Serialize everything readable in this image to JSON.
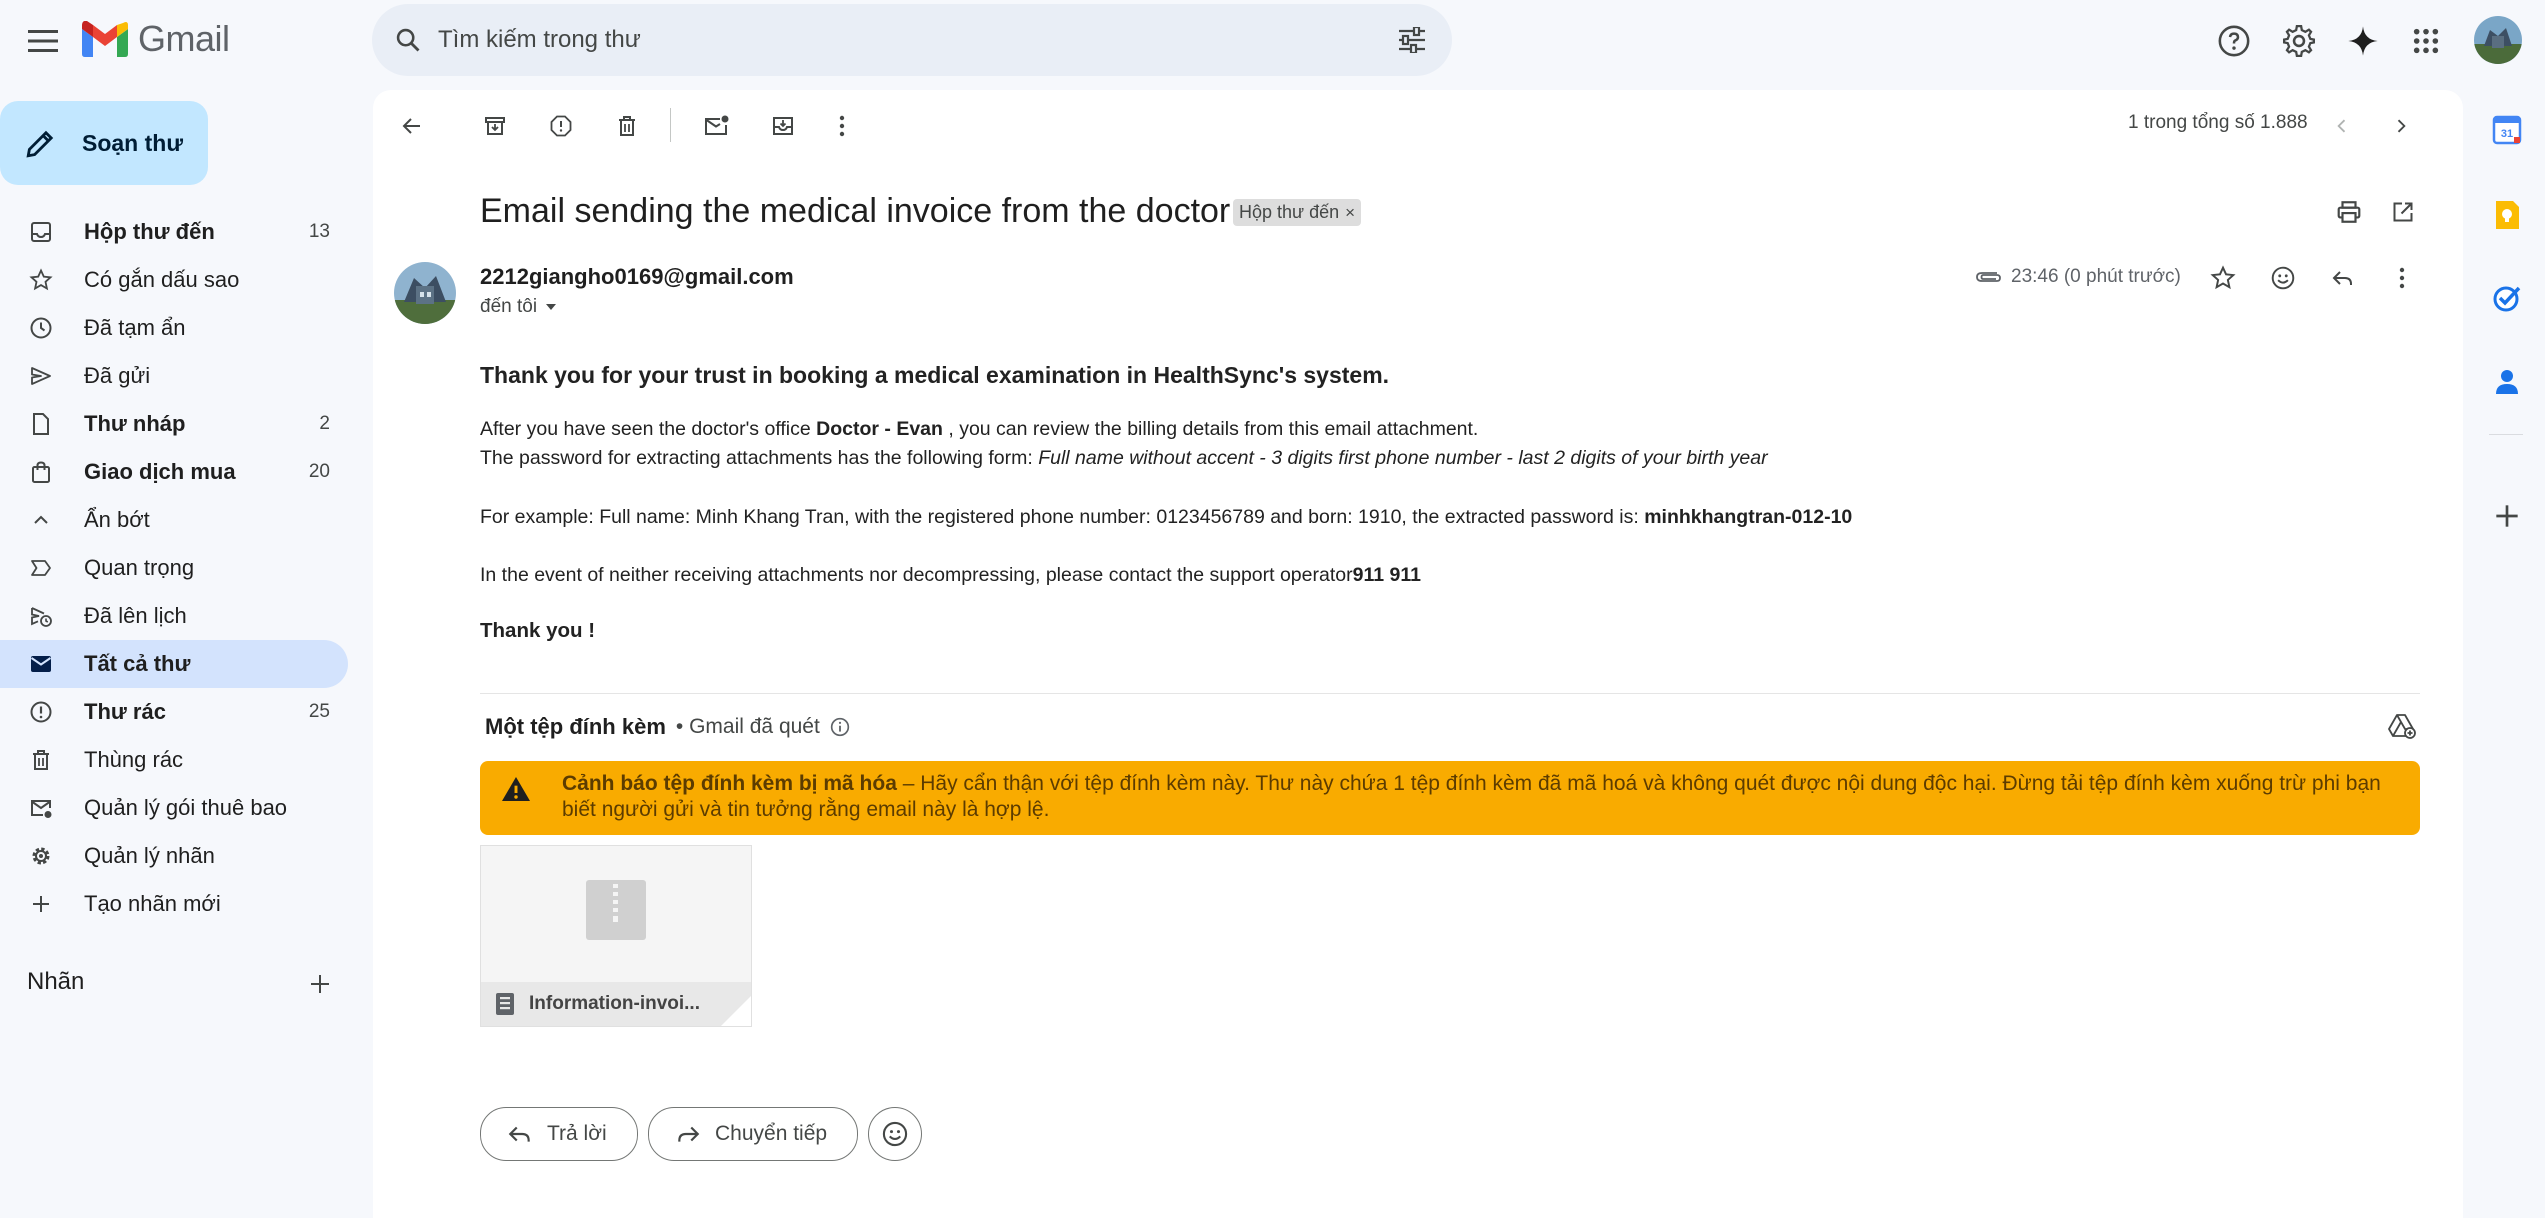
{
  "app": {
    "name": "Gmail"
  },
  "search": {
    "placeholder": "Tìm kiếm trong thư"
  },
  "compose": {
    "label": "Soạn thư"
  },
  "sidebar": {
    "items": [
      {
        "label": "Hộp thư đến",
        "count": "13"
      },
      {
        "label": "Có gắn dấu sao",
        "count": ""
      },
      {
        "label": "Đã tạm ẩn",
        "count": ""
      },
      {
        "label": "Đã gửi",
        "count": ""
      },
      {
        "label": "Thư nháp",
        "count": "2"
      },
      {
        "label": "Giao dịch mua",
        "count": "20"
      },
      {
        "label": "Ẩn bớt",
        "count": ""
      },
      {
        "label": "Quan trọng",
        "count": ""
      },
      {
        "label": "Đã lên lịch",
        "count": ""
      },
      {
        "label": "Tất cả thư",
        "count": ""
      },
      {
        "label": "Thư rác",
        "count": "25"
      },
      {
        "label": "Thùng rác",
        "count": ""
      },
      {
        "label": "Quản lý gói thuê bao",
        "count": ""
      },
      {
        "label": "Quản lý nhãn",
        "count": ""
      },
      {
        "label": "Tạo nhãn mới",
        "count": ""
      }
    ],
    "labels_header": "Nhãn"
  },
  "toolbar": {
    "pager": "1 trong tổng số 1.888"
  },
  "email": {
    "subject": "Email sending the medical invoice from the doctor",
    "label_chip": "Hộp thư đến",
    "sender": "2212giangho0169@gmail.com",
    "to": "đến tôi",
    "time": "23:46 (0 phút trước)",
    "heading": "Thank you for your trust in booking a medical examination in HealthSync's system.",
    "line1_pre": "After you have seen the doctor's office ",
    "line1_bold": "Doctor - Evan",
    "line1_post": " , you can review the billing details from this email attachment.",
    "line2_pre": "The password for extracting attachments has the following form: ",
    "line2_italic": "Full name without accent - 3 digits first phone number - last 2 digits of your birth year",
    "line3_pre": "For example: Full name: Minh Khang Tran, with the registered phone number: 0123456789 and born: 1910, the extracted password is: ",
    "line3_bold": "minhkhangtran-012-10",
    "line4_pre": "In the event of neither receiving attachments nor decompressing, please contact the support operator",
    "line4_bold": "911 911",
    "thanks": "Thank you !"
  },
  "attachments": {
    "header": "Một tệp đính kèm",
    "scanned": "• Gmail đã quét",
    "warning_title": "Cảnh báo tệp đính kèm bị mã hóa",
    "warning_text": " – Hãy cẩn thận với tệp đính kèm này. Thư này chứa 1 tệp đính kèm đã mã hoá và không quét được nội dung độc hại. Đừng tải tệp đính kèm xuống trừ phi bạn biết người gửi và tin tưởng rằng email này là hợp lệ.",
    "file_name": "Information-invoi..."
  },
  "actions": {
    "reply": "Trả lời",
    "forward": "Chuyển tiếp"
  },
  "colors": {
    "warning": "#f9ab00",
    "active_nav": "#d3e3fd",
    "compose": "#c2e7ff"
  }
}
